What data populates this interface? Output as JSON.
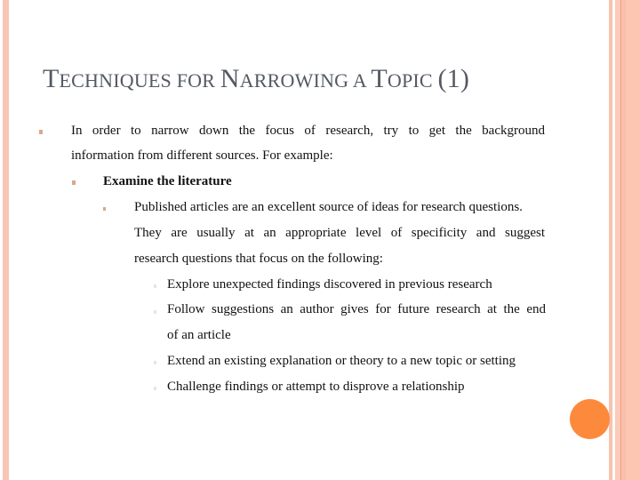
{
  "slide": {
    "title_parts": [
      {
        "cap": "T",
        "rest": "ECHNIQUES FOR "
      },
      {
        "cap": "N",
        "rest": "ARROWING A "
      },
      {
        "cap": "T",
        "rest": "OPIC "
      },
      {
        "paren": "(1)"
      }
    ],
    "title_full": "Techniques for Narrowing a Topic (1)",
    "level1": {
      "line1": "In order to narrow down the focus of research, try to get the background",
      "line2": "information from different sources. For example:"
    },
    "level2": {
      "heading": "Examine the literature"
    },
    "level3": {
      "line1": "Published articles are an excellent source of ideas for research questions.",
      "line2": "They are usually at an appropriate level of specificity and suggest",
      "line3": "research questions that focus on the following:"
    },
    "level4": [
      {
        "lines": [
          "Explore unexpected findings discovered in previous research"
        ]
      },
      {
        "lines": [
          "Follow suggestions an author gives for future research at the end",
          "of an article"
        ]
      },
      {
        "lines": [
          "Extend an existing explanation or theory to a new topic or setting"
        ]
      },
      {
        "lines": [
          "Challenge findings or attempt to disprove a relationship"
        ]
      }
    ],
    "colors": {
      "frame": "#f8c6b4",
      "accent_dot": "#fd8a3c",
      "title": "#545963",
      "bullet": "#d9a98a"
    }
  }
}
